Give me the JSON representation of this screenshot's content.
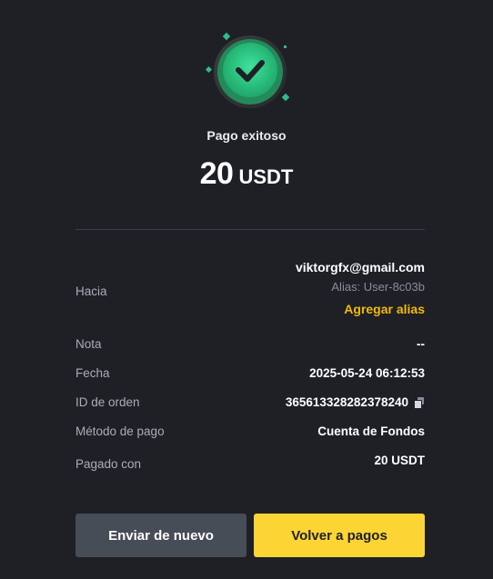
{
  "icons": {
    "success": "check-circle-icon",
    "copy": "copy-icon"
  },
  "colors": {
    "background": "#1e2026",
    "success_green": "#2ebd85",
    "accent_yellow": "#f0b90b",
    "button_primary": "#fcd535",
    "button_secondary": "#474d57"
  },
  "status": "Pago exitoso",
  "amount": {
    "value": "20",
    "currency": "USDT"
  },
  "details": {
    "to": {
      "label": "Hacia",
      "email": "viktorgfx@gmail.com",
      "alias": "Alias: User-8c03b",
      "add_alias": "Agregar alias"
    },
    "note": {
      "label": "Nota",
      "value": "--"
    },
    "date": {
      "label": "Fecha",
      "value": "2025-05-24 06:12:53"
    },
    "order_id": {
      "label": "ID de orden",
      "value": "365613328282378240"
    },
    "payment_method": {
      "label": "Método de pago",
      "value": "Cuenta de Fondos"
    },
    "paid_with": {
      "label": "Pagado con",
      "value": "20 USDT"
    }
  },
  "buttons": {
    "send_again": "Enviar de nuevo",
    "back_to_payments": "Volver a pagos"
  }
}
